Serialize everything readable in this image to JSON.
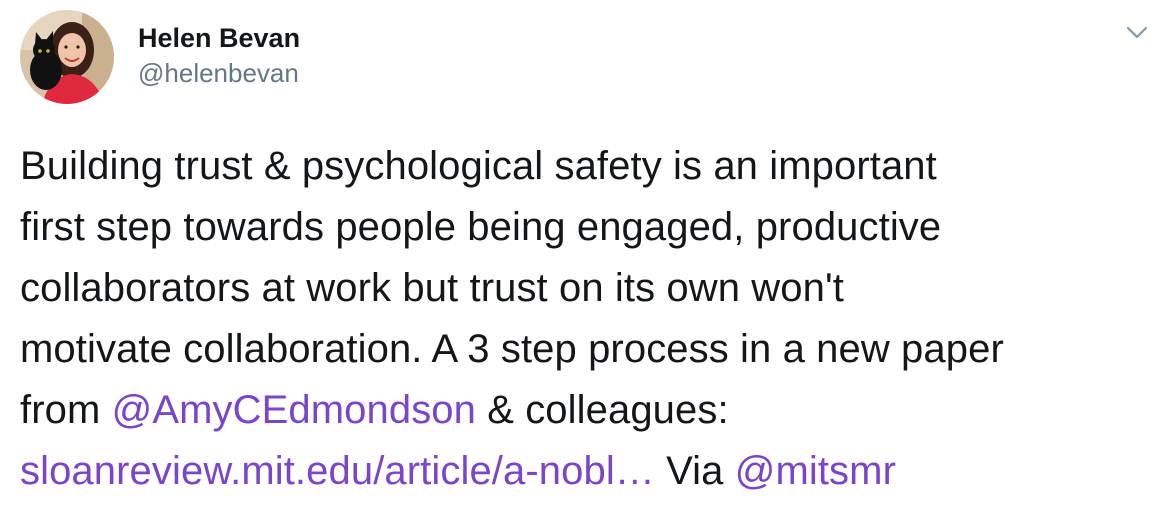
{
  "tweet": {
    "author": {
      "display_name": "Helen Bevan",
      "handle": "@helenbevan",
      "avatar_icon": "profile-photo-avatar"
    },
    "menu_icon": "chevron-down-icon",
    "colors": {
      "text": "#14171a",
      "secondary": "#657786",
      "link": "#7a45c8"
    },
    "text": {
      "line1": "Building trust & psychological safety is an important",
      "line2": "first step towards people being engaged, productive",
      "line3": "collaborators at work but trust on its own won't",
      "line4": "motivate collaboration. A 3 step process in a new paper",
      "line5_prefix": "from ",
      "mention1": "@AmyCEdmondson",
      "line5_suffix": " & colleagues:",
      "link_url": "sloanreview.mit.edu/article/a-nobl…",
      "via_text": " Via ",
      "mention2": "@mitsmr"
    }
  }
}
